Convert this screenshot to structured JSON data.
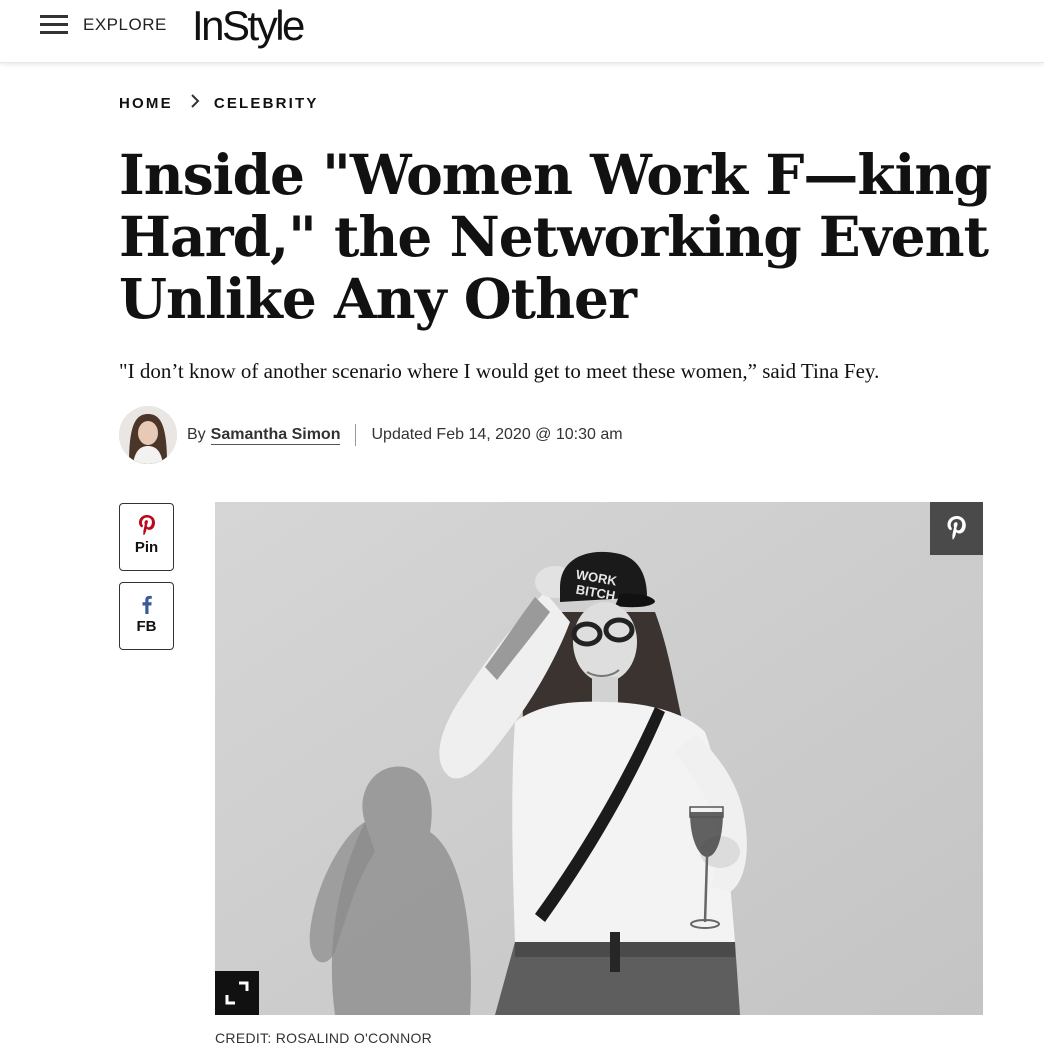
{
  "header": {
    "menu_label": "EXPLORE",
    "logo_text": "InStyle"
  },
  "breadcrumb": {
    "items": [
      "HOME",
      "CELEBRITY"
    ]
  },
  "article": {
    "headline": "Inside \"Women Work F—king Hard,\" the Networking Event Unlike Any Other",
    "dek": "\"I don’t know of another scenario where I would get to meet these women,” said Tina Fey.",
    "byline": {
      "prefix": "By",
      "author": "Samantha Simon",
      "updated": "Updated Feb 14, 2020 @ 10:30 am"
    },
    "image_credit": "CREDIT: ROSALIND O'CONNOR"
  },
  "share": {
    "pin_label": "Pin",
    "fb_label": "FB"
  },
  "colors": {
    "pinterest": "#bd081c",
    "facebook": "#3b5998",
    "text": "#111111"
  },
  "icons": [
    "hamburger-icon",
    "chevron-right-icon",
    "pinterest-icon",
    "facebook-icon",
    "expand-icon"
  ]
}
